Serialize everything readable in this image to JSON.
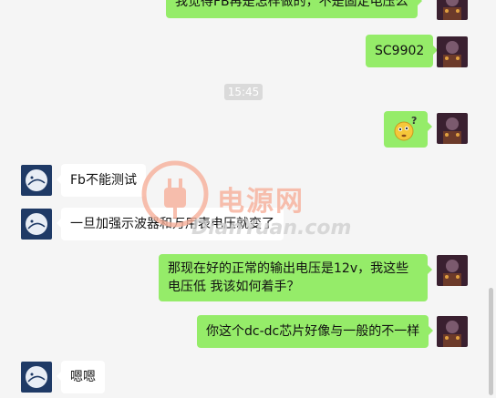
{
  "messages": [
    {
      "sender": "me",
      "text": "我觉得FB再是怎样做的，不是固定电压么",
      "kind": "text"
    },
    {
      "sender": "me",
      "text": "SC9902",
      "kind": "text"
    },
    {
      "sender": "system",
      "text": "15:45",
      "kind": "time"
    },
    {
      "sender": "me",
      "text": "",
      "kind": "sticker",
      "sticker": "confused-face-emoji"
    },
    {
      "sender": "other",
      "text": "Fb不能测试",
      "kind": "text"
    },
    {
      "sender": "other",
      "text": "一旦加强示波器和万用表电压就变了",
      "kind": "text"
    },
    {
      "sender": "me",
      "text": "那现在好的正常的输出电压是12v，我这些电压低   我该如何着手？",
      "kind": "text"
    },
    {
      "sender": "me",
      "text": "你这个dc-dc芯片好像与一般的不一样",
      "kind": "text"
    },
    {
      "sender": "other",
      "text": "嗯嗯",
      "kind": "text"
    }
  ],
  "watermark": {
    "cn": "电源网",
    "en": "DianYuan.com"
  },
  "colors": {
    "me_bubble": "#95ec69",
    "other_bubble": "#ffffff",
    "background": "#f5f5f5"
  }
}
